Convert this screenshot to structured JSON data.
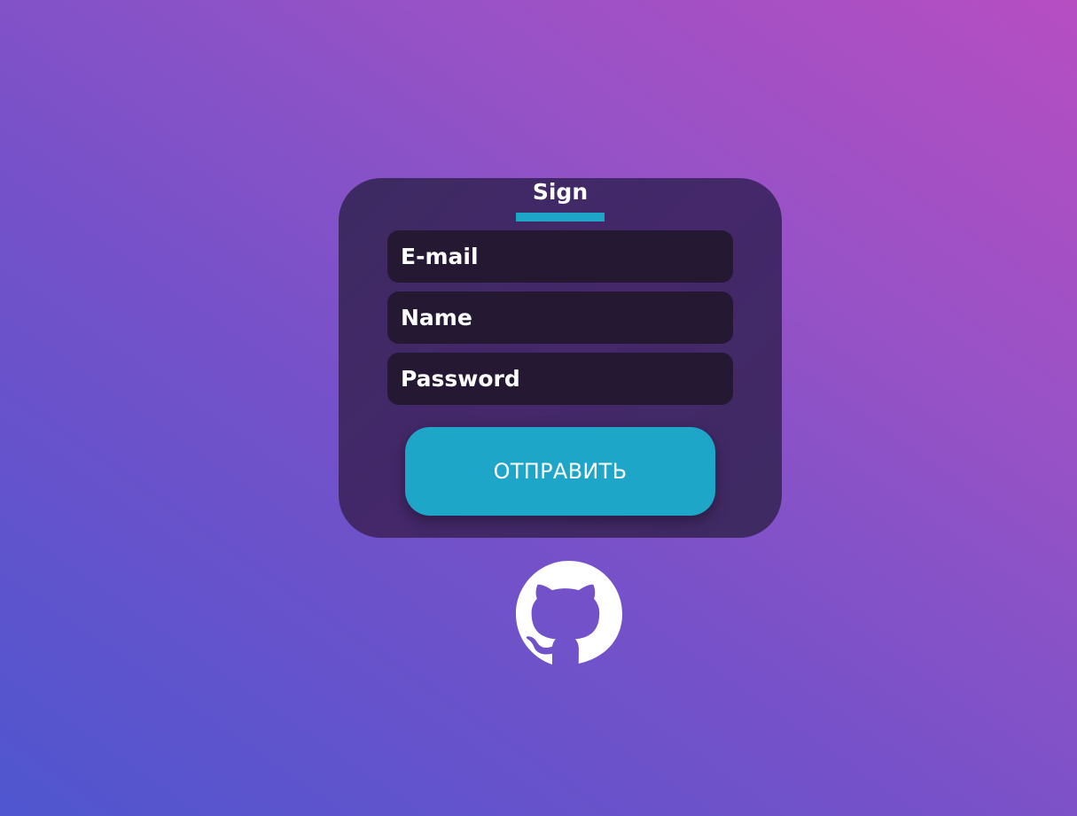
{
  "form": {
    "title": "Sign",
    "fields": {
      "email_placeholder": "E-mail",
      "name_placeholder": "Name",
      "password_placeholder": "Password"
    },
    "submit_label": "ОТПРАВИТЬ"
  },
  "footer": {
    "icon": "github-icon"
  },
  "colors": {
    "accent": "#1ea6c9",
    "card": "#44286a",
    "field": "#251833"
  }
}
